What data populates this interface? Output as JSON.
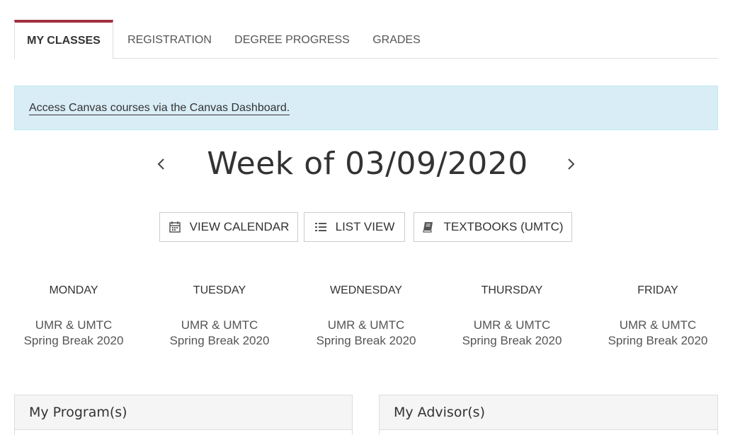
{
  "tabs": [
    {
      "label": "MY CLASSES",
      "active": true
    },
    {
      "label": "REGISTRATION",
      "active": false
    },
    {
      "label": "DEGREE PROGRESS",
      "active": false
    },
    {
      "label": "GRADES",
      "active": false
    }
  ],
  "alert": {
    "link_text": "Access Canvas courses via the Canvas Dashboard."
  },
  "week": {
    "title": "Week of 03/09/2020",
    "prev_icon": "chevron-left-icon",
    "next_icon": "chevron-right-icon"
  },
  "buttons": [
    {
      "label": "VIEW CALENDAR",
      "icon": "calendar-icon"
    },
    {
      "label": "LIST VIEW",
      "icon": "list-icon"
    },
    {
      "label": "TEXTBOOKS (UMTC)",
      "icon": "book-icon"
    }
  ],
  "days": [
    {
      "name": "MONDAY",
      "event_line1": "UMR & UMTC",
      "event_line2": "Spring Break 2020"
    },
    {
      "name": "TUESDAY",
      "event_line1": "UMR & UMTC",
      "event_line2": "Spring Break 2020"
    },
    {
      "name": "WEDNESDAY",
      "event_line1": "UMR & UMTC",
      "event_line2": "Spring Break 2020"
    },
    {
      "name": "THURSDAY",
      "event_line1": "UMR & UMTC",
      "event_line2": "Spring Break 2020"
    },
    {
      "name": "FRIDAY",
      "event_line1": "UMR & UMTC",
      "event_line2": "Spring Break 2020"
    }
  ],
  "panels": [
    {
      "title": "My Program(s)"
    },
    {
      "title": "My Advisor(s)"
    }
  ],
  "colors": {
    "accent": "#a3303f",
    "alert_bg": "#d9edf7",
    "alert_border": "#bce8f1"
  }
}
